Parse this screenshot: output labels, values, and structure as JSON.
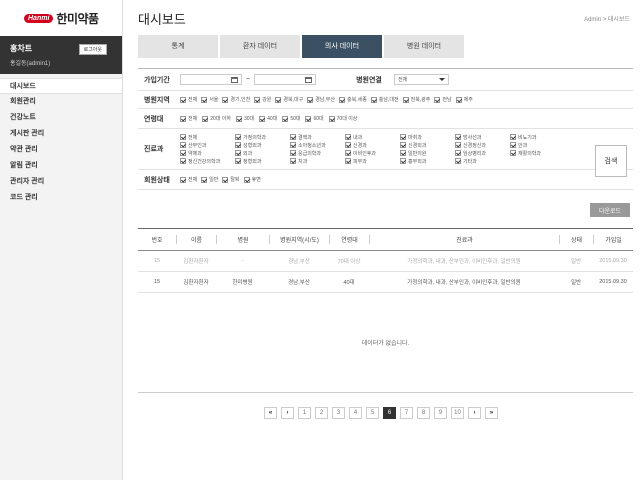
{
  "sidebar": {
    "logo": {
      "badge": "Hanmi",
      "text": "한미약품"
    },
    "user": {
      "name": "홍차트",
      "id": "홍길동(admin1)",
      "logout_label": "로그아웃"
    },
    "menu": [
      {
        "label": "대시보드",
        "active": true
      },
      {
        "label": "회원관리"
      },
      {
        "label": "건강노트"
      },
      {
        "label": "게시판 관리"
      },
      {
        "label": "약관 관리"
      },
      {
        "label": "알림 관리"
      },
      {
        "label": "관리자 관리"
      },
      {
        "label": "코드 관리"
      }
    ]
  },
  "header": {
    "title": "대시보드",
    "breadcrumb": "Admin  >  대시보드"
  },
  "tabs": [
    {
      "label": "통계"
    },
    {
      "label": "환자 데이터"
    },
    {
      "label": "의사 데이터",
      "active": true
    },
    {
      "label": "병원 데이터"
    }
  ],
  "filter": {
    "join_period": {
      "label": "가입기간",
      "separator": "~"
    },
    "hospital_link": {
      "label": "병원연결",
      "selected": "전체"
    },
    "region": {
      "label": "병원지역",
      "options": [
        "전체",
        "서울",
        "경기,인천",
        "강원",
        "경북,대구",
        "경남,부산",
        "충북,세종",
        "충남,대전",
        "전북,광주",
        "전남",
        "제주"
      ]
    },
    "age": {
      "label": "연령대",
      "options": [
        "전체",
        "20대 이하",
        "30대",
        "40대",
        "50대",
        "60대",
        "70대 이상"
      ]
    },
    "dept": {
      "label": "진료과",
      "options": [
        "전체",
        "가정의학과",
        "결핵과",
        "내과",
        "마취과",
        "방사선과",
        "비뇨기과",
        "산부인과",
        "성형외과",
        "소아청소년과",
        "신경과",
        "신경외과",
        "신경정신과",
        "안과",
        "약제과",
        "외과",
        "응급의학과",
        "이비인후과",
        "일반의원",
        "임상병리과",
        "재활의학과",
        "정신건강의학과",
        "정형외과",
        "치과",
        "피부과",
        "흉부외과",
        "기타과"
      ]
    },
    "status": {
      "label": "회원상태",
      "options": [
        "전체",
        "일반",
        "탈퇴",
        "휴면"
      ]
    },
    "search_label": "검색"
  },
  "download_label": "다운로드",
  "table": {
    "headers": [
      "번호",
      "이름",
      "병원",
      "병원지역(시/도)",
      "연령대",
      "진료과",
      "상태",
      "가입일"
    ],
    "rows": [
      [
        "15",
        "김환자환자",
        "-",
        "경남,부산",
        "70대 이상",
        "가정의학과, 내과, 산부인과, 이비인후과, 일반의원",
        "일반",
        "2015.09.30"
      ],
      [
        "15",
        "김환자환자",
        "한미병원",
        "경남,부산",
        "40대",
        "가정의학과, 내과, 산부인과, 이비인후과, 일반의원",
        "일반",
        "2015.09.30"
      ]
    ],
    "empty_text": "데이터가 없습니다."
  },
  "pagination": {
    "first": "«",
    "prev": "‹",
    "pages": [
      "1",
      "2",
      "3",
      "4",
      "5",
      "6",
      "7",
      "8",
      "9",
      "10"
    ],
    "current": "6",
    "next": "›",
    "last": "»"
  }
}
